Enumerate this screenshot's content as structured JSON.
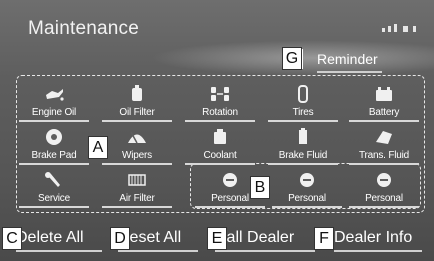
{
  "screen": {
    "title": "Maintenance"
  },
  "reminder": {
    "label": "Reminder"
  },
  "grid": {
    "row1": [
      {
        "label": "Engine Oil",
        "icon": "oil-can-icon"
      },
      {
        "label": "Oil Filter",
        "icon": "oil-filter-icon"
      },
      {
        "label": "Rotation",
        "icon": "tire-rotation-icon"
      },
      {
        "label": "Tires",
        "icon": "tire-icon"
      },
      {
        "label": "Battery",
        "icon": "battery-icon"
      }
    ],
    "row2": [
      {
        "label": "Brake Pad",
        "icon": "brake-pad-icon"
      },
      {
        "label": "Wipers",
        "icon": "wiper-icon"
      },
      {
        "label": "Coolant",
        "icon": "coolant-icon"
      },
      {
        "label": "Brake Fluid",
        "icon": "brake-fluid-icon"
      },
      {
        "label": "Trans. Fluid",
        "icon": "transmission-fluid-icon"
      }
    ],
    "row3": [
      {
        "label": "Service",
        "icon": "wrench-icon"
      },
      {
        "label": "Air Filter",
        "icon": "air-filter-icon"
      },
      {
        "label": "Personal",
        "icon": "personal-icon"
      },
      {
        "label": "Personal",
        "icon": "personal-icon"
      },
      {
        "label": "Personal",
        "icon": "personal-icon"
      }
    ]
  },
  "bottom": {
    "delete_all": "Delete All",
    "reset_all": "Reset All",
    "call_dealer": "Call Dealer",
    "dealer_info": "Dealer Info"
  },
  "callouts": {
    "a": "A",
    "b": "B",
    "c": "C",
    "d": "D",
    "e": "E",
    "f": "F",
    "g": "G"
  },
  "colors": {
    "screen_bg": "#5e5e5e",
    "text": "#ffffff",
    "dash": "#e8e8e8"
  }
}
